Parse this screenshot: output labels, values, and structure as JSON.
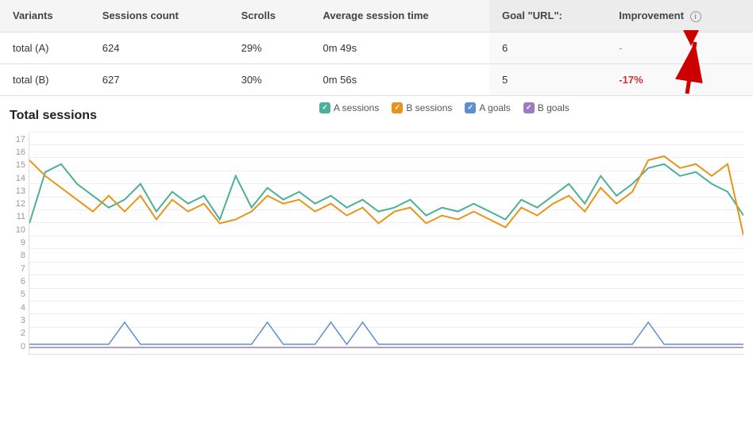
{
  "table": {
    "headers": [
      "Variants",
      "Sessions count",
      "Scrolls",
      "Average session time",
      "Goal \"URL\":",
      "Improvement"
    ],
    "rows": [
      {
        "variant": "total (A)",
        "sessions": "624",
        "scrolls": "29%",
        "avg_session": "0m 49s",
        "goal": "6",
        "improvement": "-",
        "improvement_type": "neutral"
      },
      {
        "variant": "total (B)",
        "sessions": "627",
        "scrolls": "30%",
        "avg_session": "0m 56s",
        "goal": "5",
        "improvement": "-17%",
        "improvement_type": "negative"
      }
    ]
  },
  "chart": {
    "title": "Total sessions",
    "legend": [
      {
        "label": "A sessions",
        "color": "#4CAF9A",
        "type": "check"
      },
      {
        "label": "B sessions",
        "color": "#E8941A",
        "type": "check"
      },
      {
        "label": "A goals",
        "color": "#5B8FD4",
        "type": "check"
      },
      {
        "label": "B goals",
        "color": "#9C7BC4",
        "type": "check"
      }
    ],
    "y_labels": [
      "0",
      "2",
      "3",
      "4",
      "5",
      "6",
      "7",
      "8",
      "9",
      "10",
      "11",
      "12",
      "13",
      "14",
      "15",
      "16",
      "17"
    ]
  },
  "icons": {
    "info": "i",
    "check": "✓"
  }
}
